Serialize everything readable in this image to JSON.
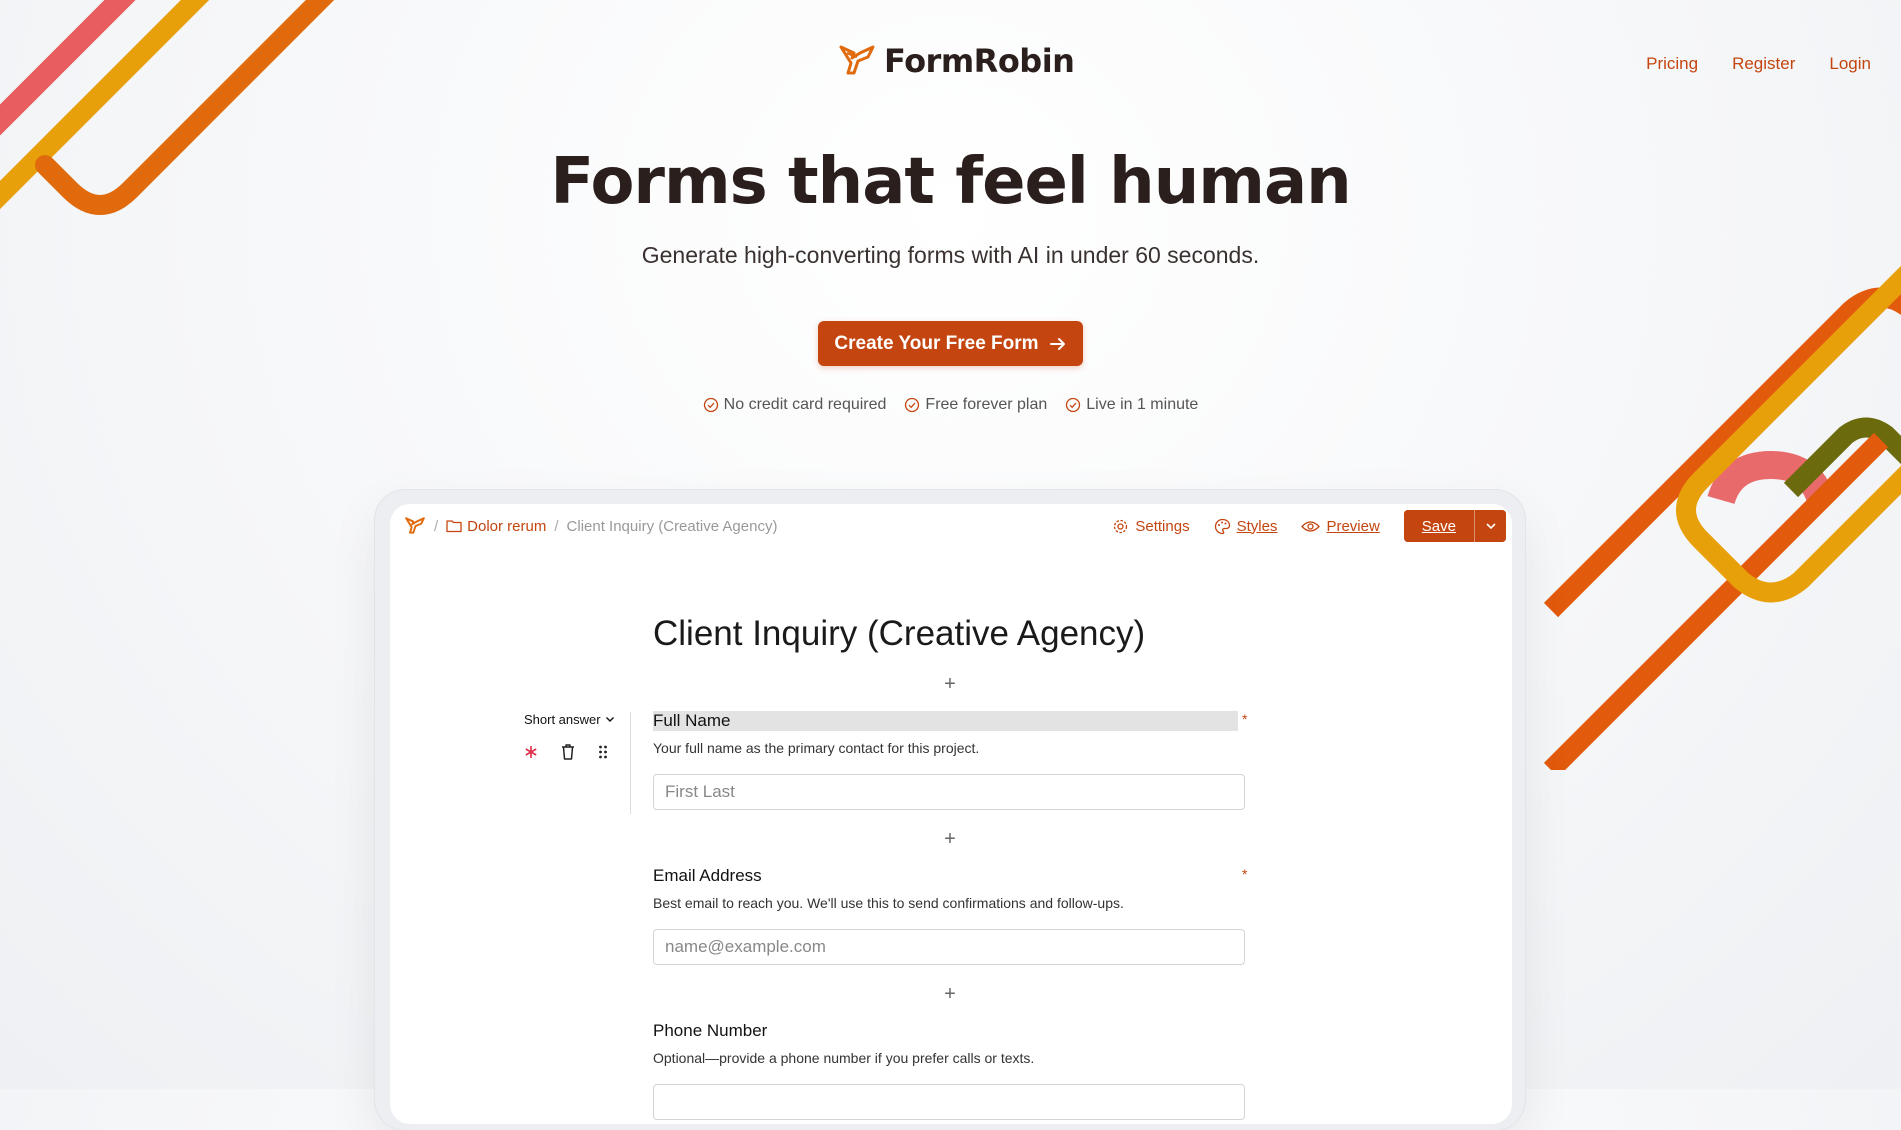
{
  "brand": {
    "name": "FormRobin",
    "accent": "#c4450f"
  },
  "nav": {
    "items": [
      "Pricing",
      "Register",
      "Login"
    ]
  },
  "hero": {
    "title": "Forms that feel human",
    "subtitle": "Generate high-converting forms with AI in under 60 seconds.",
    "cta": "Create Your Free Form",
    "perks": [
      "No credit card required",
      "Free forever plan",
      "Live in 1 minute"
    ]
  },
  "editor": {
    "breadcrumb": {
      "folder": "Dolor rerum",
      "current": "Client Inquiry (Creative Agency)"
    },
    "toolbar": {
      "settings": "Settings",
      "styles": "Styles",
      "preview": "Preview",
      "save": "Save"
    },
    "form_title": "Client Inquiry (Creative Agency)",
    "field_type": "Short answer",
    "required_mark": "*",
    "questions": [
      {
        "label": "Full Name",
        "description": "Your full name as the primary contact for this project.",
        "placeholder": "First Last",
        "required": true
      },
      {
        "label": "Email Address",
        "description": "Best email to reach you. We'll use this to send confirmations and follow-ups.",
        "placeholder": "name@example.com",
        "required": true
      },
      {
        "label": "Phone Number",
        "description": "Optional—provide a phone number if you prefer calls or texts.",
        "required": false
      }
    ]
  }
}
